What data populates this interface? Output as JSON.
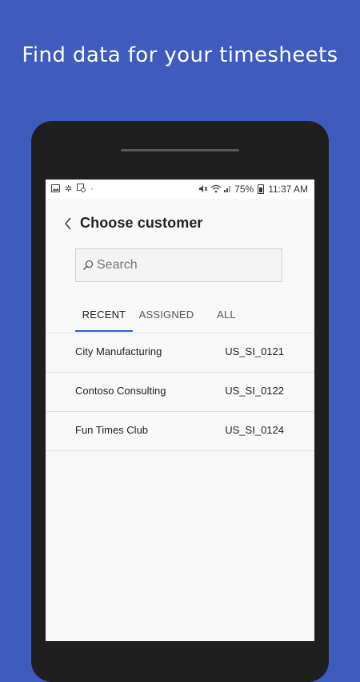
{
  "banner": {
    "headline": "Find data for your timesheets"
  },
  "status_bar": {
    "battery": "75%",
    "time": "11:37 AM"
  },
  "header": {
    "title": "Choose customer"
  },
  "search": {
    "placeholder": "Search",
    "value": ""
  },
  "tabs": [
    {
      "label": "RECENT",
      "active": true
    },
    {
      "label": "ASSIGNED",
      "active": false
    },
    {
      "label": "ALL",
      "active": false
    }
  ],
  "customers": [
    {
      "name": "City Manufacturing",
      "code": "US_SI_0121"
    },
    {
      "name": "Contoso Consulting",
      "code": "US_SI_0122"
    },
    {
      "name": "Fun Times Club",
      "code": "US_SI_0124"
    }
  ],
  "colors": {
    "background": "#3f5bbd",
    "accent": "#2b63c7",
    "phone_body": "#1f1f1f"
  }
}
